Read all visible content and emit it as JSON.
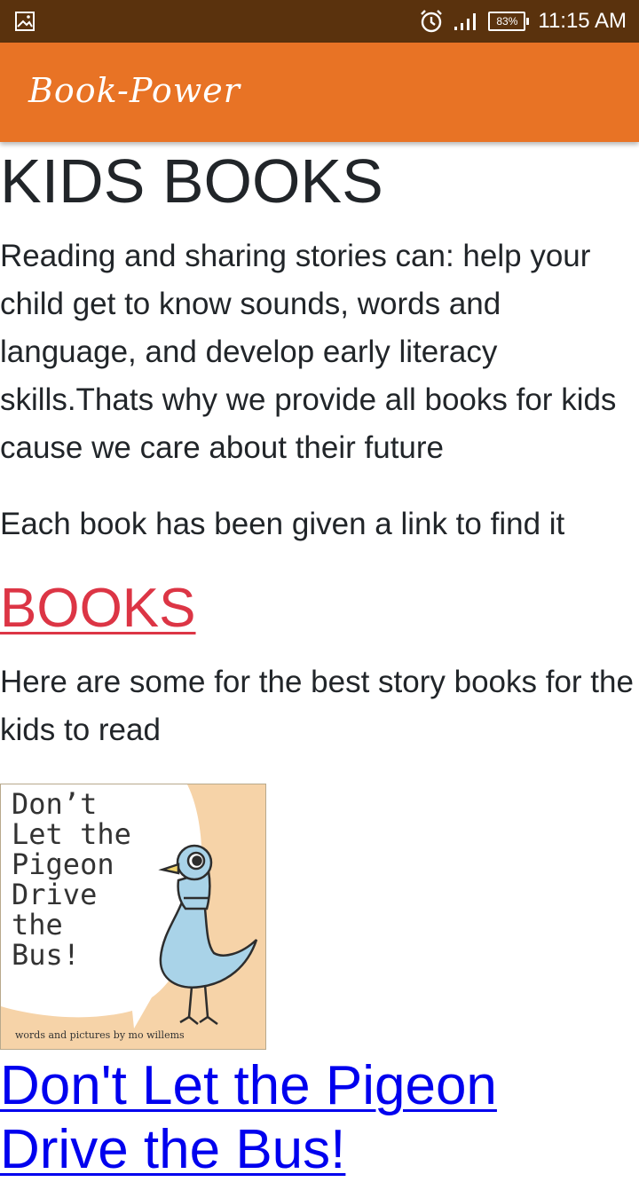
{
  "status_bar": {
    "battery": "83%",
    "time": "11:15 AM"
  },
  "toolbar": {
    "title": "Book-Power"
  },
  "page": {
    "title": "KIDS BOOKS",
    "intro": "Reading and sharing stories can: help your child get to know sounds, words and language, and develop early literacy skills.Thats why we provide all books for kids cause we care about their future",
    "note": "Each book has been given a link to find it",
    "books_heading": "BOOKS",
    "books_description": "Here are some for the best story books for the kids to read",
    "books": [
      {
        "cover_lines": [
          "Don’t",
          "Let the",
          "Pigeon",
          "Drive",
          "the",
          "Bus!"
        ],
        "cover_credit": "words and pictures by mo willems",
        "title": "Don't Let the Pigeon Drive the Bus!"
      }
    ]
  },
  "colors": {
    "status_bar": "#5a320d",
    "toolbar": "#e87325",
    "heading_link": "#dc3545",
    "book_link": "#0000ee"
  },
  "icons": {
    "status_left": "gallery-icon",
    "status_right": [
      "alarm-icon",
      "signal-icon",
      "battery-icon"
    ]
  }
}
